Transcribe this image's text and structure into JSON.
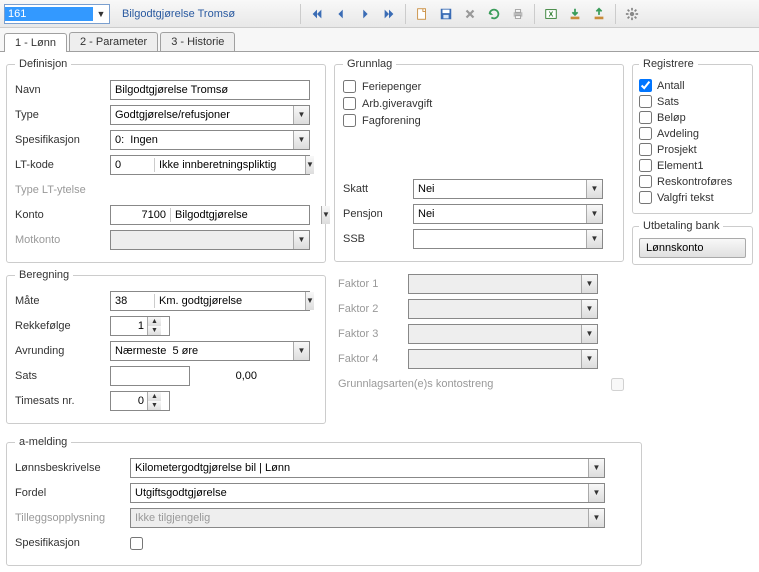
{
  "header": {
    "id": "161",
    "title": "Bilgodtgjørelse Tromsø"
  },
  "tabs": [
    "1 - Lønn",
    "2 - Parameter",
    "3 - Historie"
  ],
  "definisjon": {
    "legend": "Definisjon",
    "navn_lbl": "Navn",
    "navn": "Bilgodtgjørelse Tromsø",
    "type_lbl": "Type",
    "type": "Godtgjørelse/refusjoner",
    "spes_lbl": "Spesifikasjon",
    "spes": "0:  Ingen",
    "ltkode_lbl": "LT-kode",
    "ltkode_code": "0",
    "ltkode_text": "Ikke innberetningspliktig",
    "ltytelse_lbl": "Type LT-ytelse",
    "konto_lbl": "Konto",
    "konto_code": "7100",
    "konto_text": "Bilgodtgjørelse",
    "motkonto_lbl": "Motkonto"
  },
  "beregning": {
    "legend": "Beregning",
    "mate_lbl": "Måte",
    "mate_code": "38",
    "mate_text": "Km. godtgjørelse",
    "rekke_lbl": "Rekkefølge",
    "rekke": "1",
    "avr_lbl": "Avrunding",
    "avr": "Nærmeste  5 øre",
    "sats_lbl": "Sats",
    "sats": "0,00",
    "timesats_lbl": "Timesats nr.",
    "timesats": "0"
  },
  "grunnlag": {
    "legend": "Grunnlag",
    "feriepenger": "Feriepenger",
    "arbgiver": "Arb.giveravgift",
    "fagforening": "Fagforening",
    "skatt_lbl": "Skatt",
    "skatt": "Nei",
    "pensjon_lbl": "Pensjon",
    "pensjon": "Nei",
    "ssb_lbl": "SSB",
    "ssb": "",
    "faktor1": "Faktor 1",
    "faktor2": "Faktor 2",
    "faktor3": "Faktor 3",
    "faktor4": "Faktor 4",
    "grunnlagsart": "Grunnlagsarten(e)s kontostreng"
  },
  "registrere": {
    "legend": "Registrere",
    "antall": "Antall",
    "sats": "Sats",
    "belop": "Beløp",
    "avdeling": "Avdeling",
    "prosjekt": "Prosjekt",
    "element1": "Element1",
    "reskontro": "Reskontroføres",
    "valgfri": "Valgfri tekst"
  },
  "utbetaling": {
    "legend": "Utbetaling bank",
    "lonnskonto": "Lønnskonto"
  },
  "amelding": {
    "legend": "a-melding",
    "lonnsbesk_lbl": "Lønnsbeskrivelse",
    "lonnsbesk": "Kilometergodtgjørelse bil | Lønn",
    "fordel_lbl": "Fordel",
    "fordel": "Utgiftsgodtgjørelse",
    "tillegg_lbl": "Tilleggsopplysning",
    "tillegg": "Ikke tilgjengelig",
    "spes_lbl": "Spesifikasjon"
  }
}
